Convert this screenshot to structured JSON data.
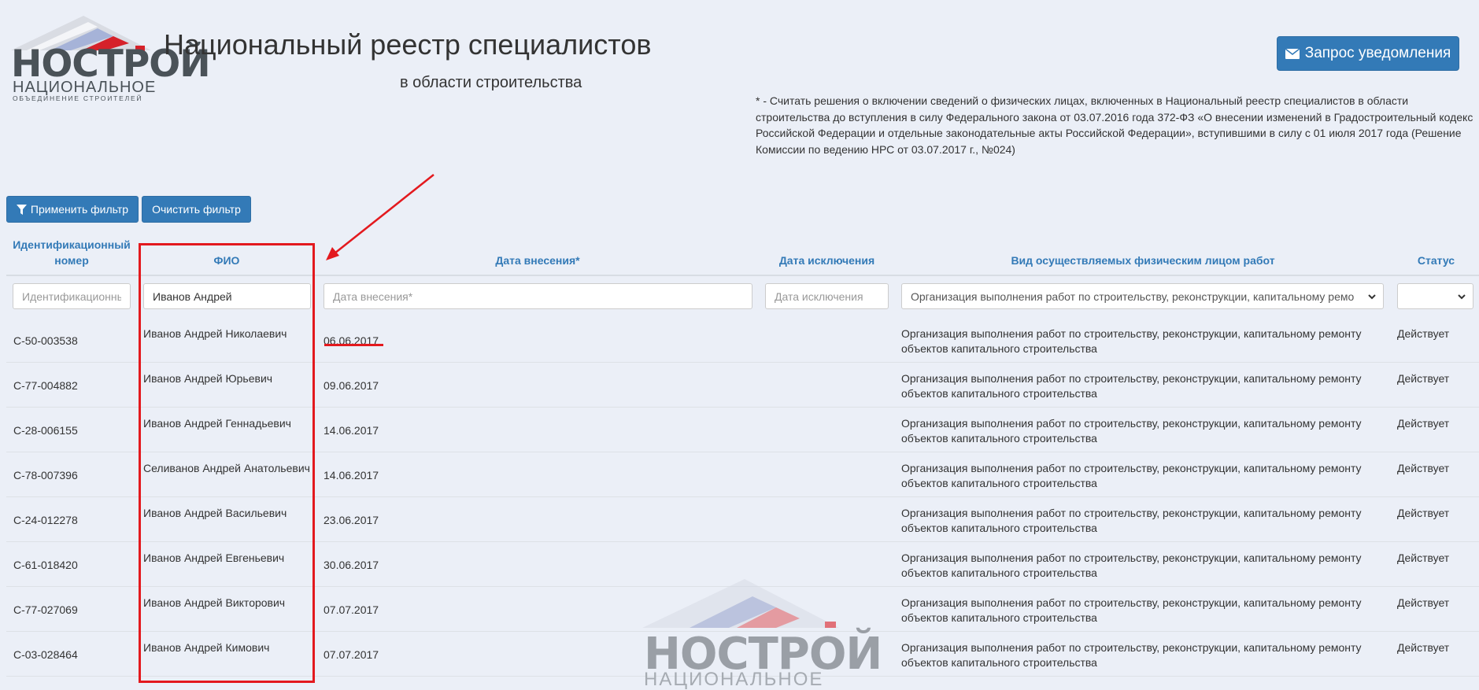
{
  "logo": {
    "word": "НОСТРОЙ",
    "line1": "НАЦИОНАЛЬНОЕ",
    "line2": "ОБЪЕДИНЕНИЕ СТРОИТЕЛЕЙ"
  },
  "header": {
    "title": "Национальный реестр специалистов",
    "subtitle": "в области строительства",
    "notify_button": "Запрос уведомления",
    "note": "* - Считать решения о включении сведений о физических лицах, включенных в Национальный реестр специалистов в области строительства до вступления в силу Федерального закона от 03.07.2016 года 372-ФЗ «О внесении изменений в Градостроительный кодекс Российской Федерации и отдельные законодательные акты Российской Федерации», вступившими в силу с 01 июля 2017 года (Решение Комиссии по ведению НРС от 03.07.2017 г., №024)"
  },
  "toolbar": {
    "apply_filter": "Применить фильтр",
    "clear_filter": "Очистить фильтр"
  },
  "table": {
    "headers": {
      "id_line1": "Идентификационный",
      "id_line2": "номер",
      "fio": "ФИО",
      "date_in": "Дата внесения*",
      "date_out": "Дата исключения",
      "work": "Вид осуществляемых физическим лицом работ",
      "status": "Статус"
    },
    "filters": {
      "id_placeholder": "Идентификационный номер",
      "fio_value": "Иванов Андрей",
      "date_in_placeholder": "Дата внесения*",
      "date_out_placeholder": "Дата исключения",
      "work_selected": "Организация выполнения работ по строительству, реконструкции, капитальному ремонту объектов капитального строительства",
      "status_selected": ""
    },
    "rows": [
      {
        "id": "С-50-003538",
        "fio": "Иванов Андрей Николаевич",
        "date": "06.06.2017",
        "work": "Организация выполнения работ по строительству, реконструкции, капитальному ремонту объектов капитального строительства",
        "status": "Действует"
      },
      {
        "id": "С-77-004882",
        "fio": "Иванов Андрей Юрьевич",
        "date": "09.06.2017",
        "work": "Организация выполнения работ по строительству, реконструкции, капитальному ремонту объектов капитального строительства",
        "status": "Действует"
      },
      {
        "id": "С-28-006155",
        "fio": "Иванов Андрей Геннадьевич",
        "date": "14.06.2017",
        "work": "Организация выполнения работ по строительству, реконструкции, капитальному ремонту объектов капитального строительства",
        "status": "Действует"
      },
      {
        "id": "С-78-007396",
        "fio": "Селиванов Андрей Анатольевич",
        "date": "14.06.2017",
        "work": "Организация выполнения работ по строительству, реконструкции, капитальному ремонту объектов капитального строительства",
        "status": "Действует"
      },
      {
        "id": "С-24-012278",
        "fio": "Иванов Андрей Васильевич",
        "date": "23.06.2017",
        "work": "Организация выполнения работ по строительству, реконструкции, капитальному ремонту объектов капитального строительства",
        "status": "Действует"
      },
      {
        "id": "С-61-018420",
        "fio": "Иванов Андрей Евгеньевич",
        "date": "30.06.2017",
        "work": "Организация выполнения работ по строительству, реконструкции, капитальному ремонту объектов капитального строительства",
        "status": "Действует"
      },
      {
        "id": "С-77-027069",
        "fio": "Иванов Андрей Викторович",
        "date": "07.07.2017",
        "work": "Организация выполнения работ по строительству, реконструкции, капитальному ремонту объектов капитального строительства",
        "status": "Действует"
      },
      {
        "id": "С-03-028464",
        "fio": "Иванов Андрей Кимович",
        "date": "07.07.2017",
        "work": "Организация выполнения работ по строительству, реконструкции, капитальному ремонту объектов капитального строительства",
        "status": "Действует"
      }
    ]
  },
  "watermark": {
    "word": "НОСТРОЙ",
    "line1": "НАЦИОНАЛЬНОЕ"
  },
  "colors": {
    "background": "#ebeff7",
    "primary": "#337ab7",
    "annotation_red": "#e3191e",
    "header_text": "#337ab7"
  },
  "icons": {
    "notify": "envelope-icon",
    "apply": "filter-icon",
    "select": "chevron-down-icon"
  }
}
